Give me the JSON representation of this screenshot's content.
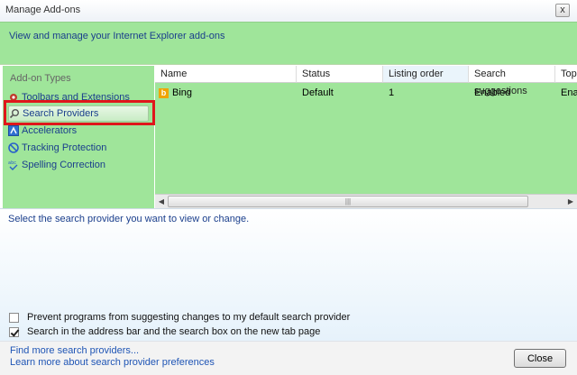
{
  "window": {
    "title": "Manage Add-ons",
    "close_glyph": "x"
  },
  "header": {
    "description": "View and manage your Internet Explorer add-ons"
  },
  "sidebar": {
    "heading": "Add-on Types",
    "items": [
      {
        "label": "Toolbars and Extensions",
        "icon": "gear-icon"
      },
      {
        "label": "Search Providers",
        "icon": "search-icon",
        "selected": true
      },
      {
        "label": "Accelerators",
        "icon": "accelerator-icon"
      },
      {
        "label": "Tracking Protection",
        "icon": "tracking-protection-icon"
      },
      {
        "label": "Spelling Correction",
        "icon": "spelling-icon"
      }
    ]
  },
  "list": {
    "columns": [
      "Name",
      "Status",
      "Listing order",
      "Search suggestions",
      "Top"
    ],
    "rows": [
      {
        "name": "Bing",
        "status": "Default",
        "order": "1",
        "suggestions": "Enabled",
        "top": "Ena"
      }
    ]
  },
  "details": {
    "hint": "Select the search provider you want to view or change.",
    "checkboxes": [
      {
        "label": "Prevent programs from suggesting changes to my default search provider",
        "checked": false
      },
      {
        "label": "Search in the address bar and the search box on the new tab page",
        "checked": true
      }
    ]
  },
  "footer": {
    "links": [
      "Find more search providers...",
      "Learn more about search provider preferences"
    ],
    "close_label": "Close"
  },
  "colors": {
    "green": "#9fe59a",
    "link": "#1f55b5",
    "highlight": "#e0161b"
  }
}
